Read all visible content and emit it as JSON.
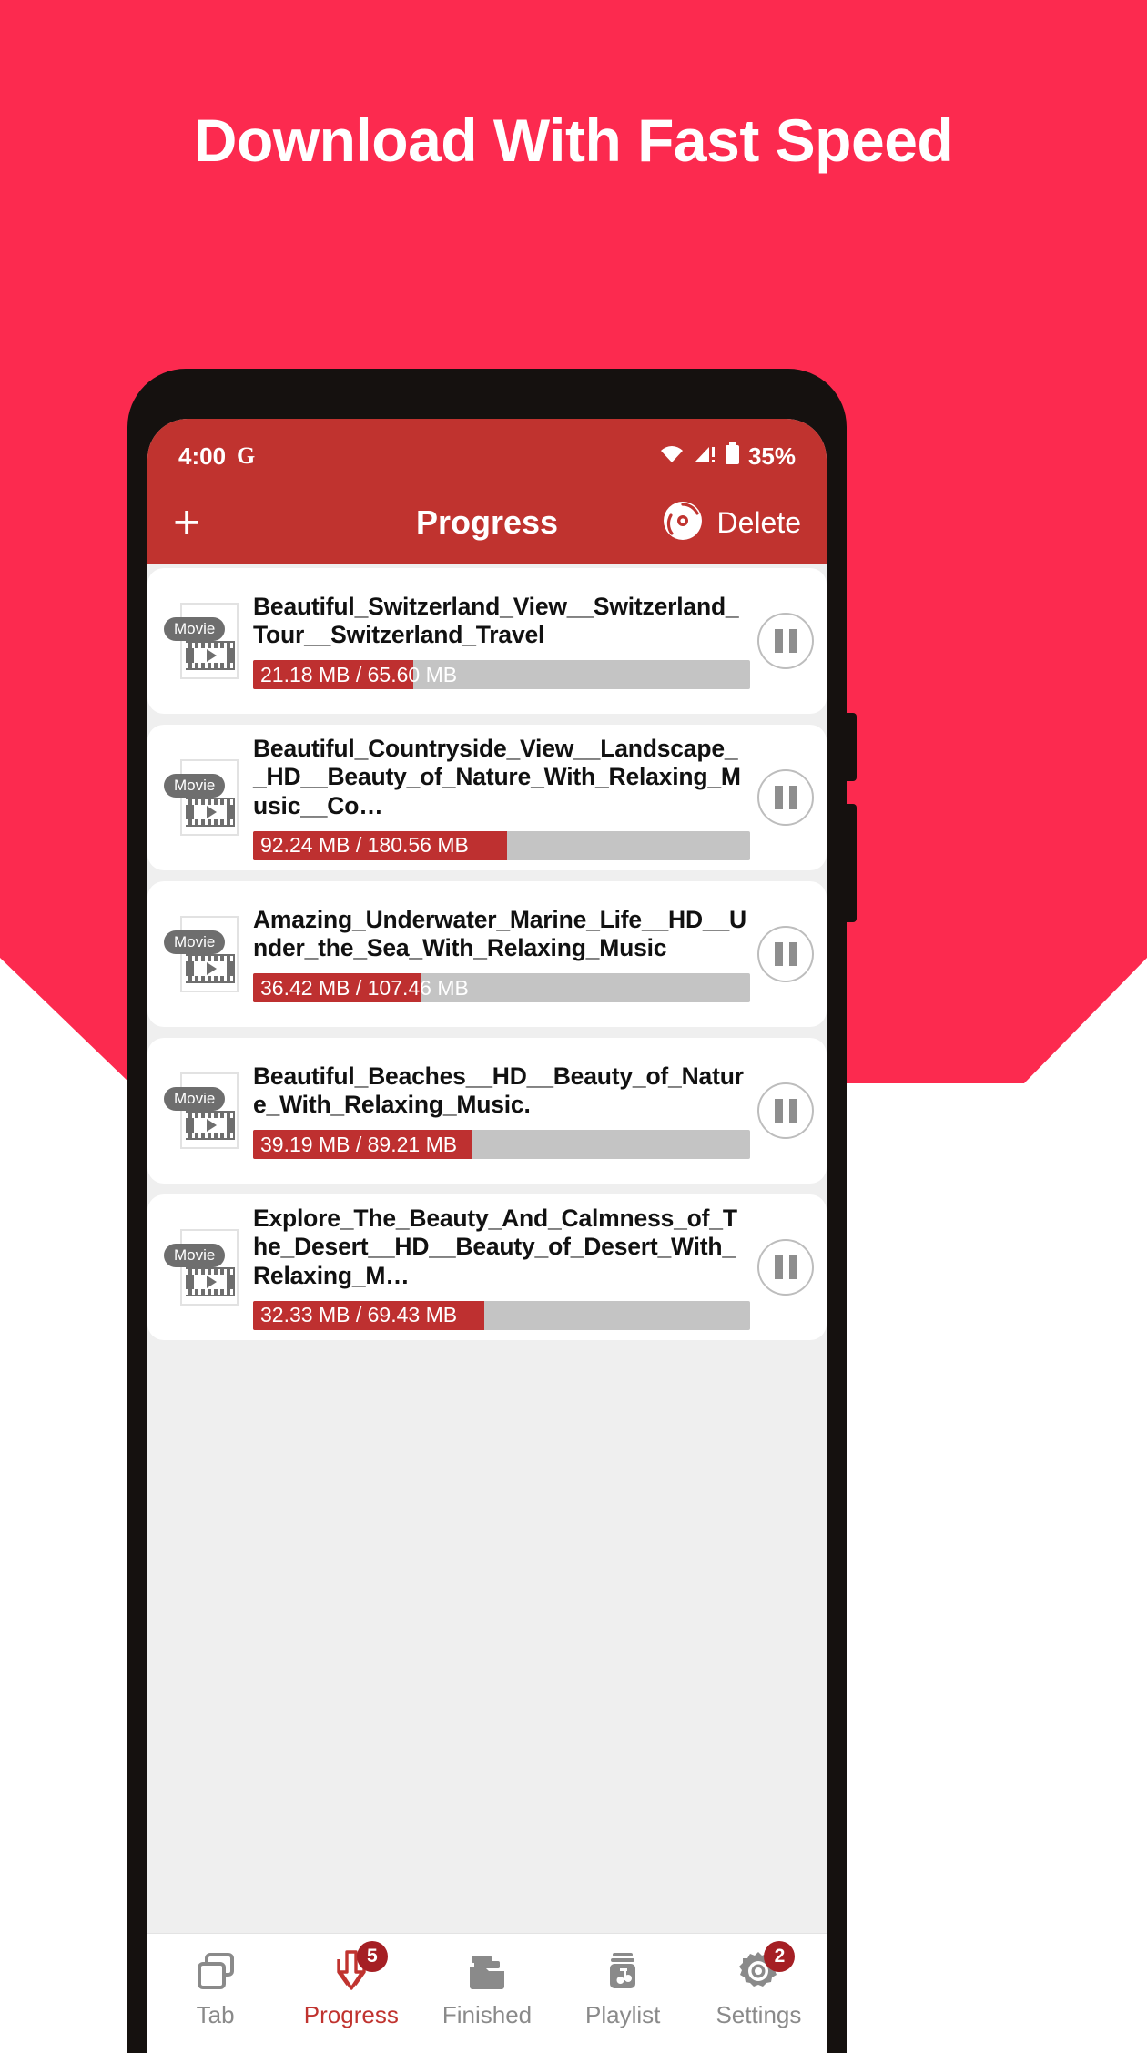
{
  "promo": {
    "headline": "Download With Fast Speed",
    "bg_color": "#FC2A4F"
  },
  "status_bar": {
    "time": "4:00",
    "assistant_icon": "google-g-icon",
    "wifi_icon": "wifi-icon",
    "signal_icon": "cellular-signal-icon",
    "battery_icon": "battery-icon",
    "battery_text": "35%"
  },
  "app_bar": {
    "add_icon": "plus-icon",
    "title": "Progress",
    "disc_icon": "disc-icon",
    "delete_label": "Delete",
    "bg_color": "#C0332F"
  },
  "downloads": [
    {
      "thumb_badge": "Movie",
      "title": "Beautiful_Switzerland_View__Switzerland_Tour__Switzerland_Travel",
      "progress_text": "21.18 MB / 65.60 MB",
      "downloaded": "21.18 MB",
      "total": "65.60 MB",
      "percent": 32.3,
      "action_icon": "pause-icon"
    },
    {
      "thumb_badge": "Movie",
      "title": "Beautiful_Countryside_View__Landscape__HD__Beauty_of_Nature_With_Relaxing_Music__Co…",
      "progress_text": "92.24 MB / 180.56 MB",
      "downloaded": "92.24 MB",
      "total": "180.56 MB",
      "percent": 51.1,
      "action_icon": "pause-icon"
    },
    {
      "thumb_badge": "Movie",
      "title": "Amazing_Underwater_Marine_Life__HD__Under_the_Sea_With_Relaxing_Music",
      "progress_text": "36.42 MB / 107.46 MB",
      "downloaded": "36.42 MB",
      "total": "107.46 MB",
      "percent": 33.9,
      "action_icon": "pause-icon"
    },
    {
      "thumb_badge": "Movie",
      "title": "Beautiful_Beaches__HD__Beauty_of_Nature_With_Relaxing_Music.",
      "progress_text": "39.19 MB / 89.21 MB",
      "downloaded": "39.19 MB",
      "total": "89.21 MB",
      "percent": 43.9,
      "action_icon": "pause-icon"
    },
    {
      "thumb_badge": "Movie",
      "title": "Explore_The_Beauty_And_Calmness_of_The_Desert__HD__Beauty_of_Desert_With_Relaxing_M…",
      "progress_text": "32.33 MB / 69.43 MB",
      "downloaded": "32.33 MB",
      "total": "69.43 MB",
      "percent": 46.6,
      "action_icon": "pause-icon"
    }
  ],
  "bottom_nav": {
    "items": [
      {
        "label": "Tab",
        "icon": "tabs-icon",
        "badge": "",
        "active": false
      },
      {
        "label": "Progress",
        "icon": "download-arrow-icon",
        "badge": "5",
        "active": true
      },
      {
        "label": "Finished",
        "icon": "folder-icon",
        "badge": "",
        "active": false
      },
      {
        "label": "Playlist",
        "icon": "music-note-icon",
        "badge": "",
        "active": false
      },
      {
        "label": "Settings",
        "icon": "gear-icon",
        "badge": "2",
        "active": false
      }
    ]
  },
  "colors": {
    "promo_pink": "#FC2A4F",
    "app_red": "#C0332F",
    "progress_red": "#BE3030",
    "badge_red": "#A51F24",
    "track_gray": "#C4C4C4"
  }
}
